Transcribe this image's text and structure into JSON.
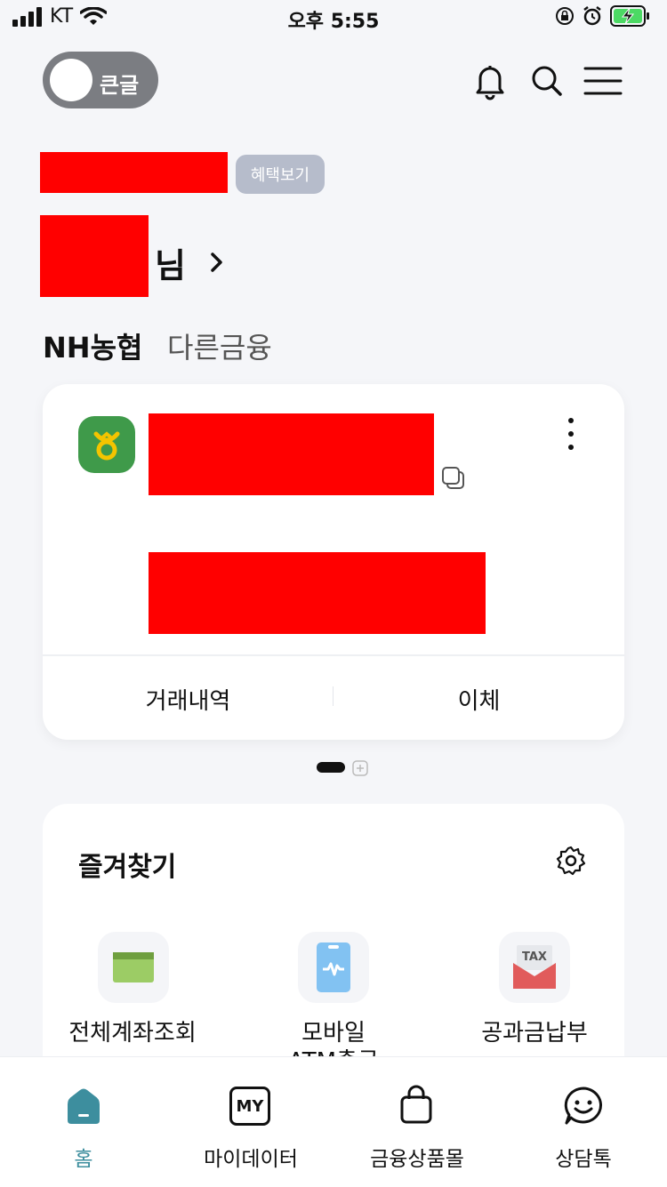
{
  "status": {
    "carrier": "KT",
    "time": "오후 5:55"
  },
  "top": {
    "toggle_label": "큰글",
    "icons": [
      "bell-icon",
      "search-icon",
      "menu-icon"
    ]
  },
  "user": {
    "benefit_label": "혜택보기",
    "suffix": "님"
  },
  "tabs": [
    "NH농협",
    "다른금융"
  ],
  "account_card": {
    "actions": [
      "거래내역",
      "이체"
    ]
  },
  "favorites": {
    "title": "즐겨찾기",
    "items": [
      {
        "label": "전체계좌조회",
        "icon": "wallet-icon"
      },
      {
        "label": "모바일\nATM출금",
        "icon": "mobile-atm-icon"
      },
      {
        "label": "공과금납부",
        "icon": "tax-envelope-icon",
        "badge": "TAX"
      }
    ]
  },
  "tabbar": {
    "items": [
      {
        "label": "홈",
        "icon": "home-icon",
        "active": true
      },
      {
        "label": "마이데이터",
        "icon": "my-icon",
        "icon_text": "MY"
      },
      {
        "label": "금융상품몰",
        "icon": "shopping-bag-icon"
      },
      {
        "label": "상담톡",
        "icon": "chat-smile-icon"
      }
    ]
  },
  "colors": {
    "accent": "#3d8e9e",
    "brand_green": "#3f9a4a",
    "redaction": "#ff0000"
  }
}
